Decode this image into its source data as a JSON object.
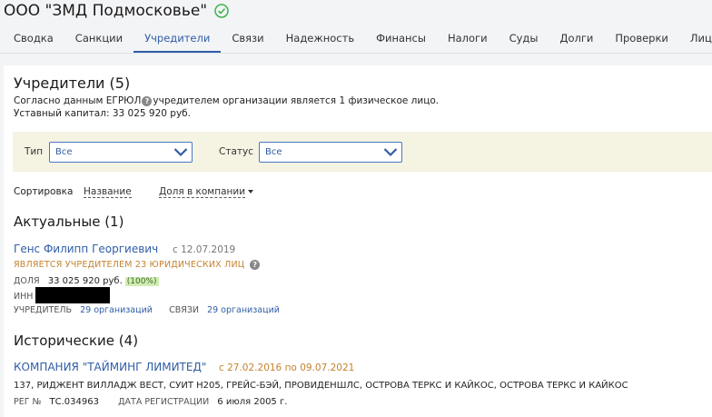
{
  "header": {
    "company": "ООО \"ЗМД Подмосковье\""
  },
  "tabs": [
    "Сводка",
    "Санкции",
    "Учредители",
    "Связи",
    "Надежность",
    "Финансы",
    "Налоги",
    "Суды",
    "Долги",
    "Проверки",
    "Лицен"
  ],
  "active_tab": "Учредители",
  "section": {
    "title": "Учредители (5)",
    "info_before": "Согласно данным ЕГРЮЛ",
    "info_after": "учредителем организации является 1 физическое лицо.",
    "capital": "Уставный капитал: 33 025 920 руб."
  },
  "filters": {
    "type_label": "Тип",
    "type_value": "Все",
    "status_label": "Статус",
    "status_value": "Все"
  },
  "sort": {
    "label": "Сортировка",
    "by_name": "Название",
    "by_share": "Доля в компании"
  },
  "actual": {
    "title": "Актуальные (1)",
    "person": "Генс Филипп Георгиевич",
    "since": "с 12.07.2019",
    "role": "ЯВЛЯЕТСЯ УЧРЕДИТЕЛЕМ 23 ЮРИДИЧЕСКИХ ЛИЦ",
    "share_label": "ДОЛЯ",
    "share_value": "33 025 920 руб.",
    "share_pct": "(100%)",
    "inn_label": "ИНН",
    "founder_label": "УЧРЕДИТЕЛЬ",
    "founder_link": "29 организаций",
    "links_label": "СВЯЗИ",
    "links_link": "29 организаций"
  },
  "historic": {
    "title": "Исторические (4)",
    "company": "КОМПАНИЯ \"ТАЙМИНГ ЛИМИТЕД\"",
    "dates": "с 27.02.2016 по 09.07.2021",
    "address": "137, РИДЖЕНТ ВИЛЛАДЖ ВЕСТ, СУИТ Н205, ГРЕЙС-БЭЙ, ПРОВИДЕНШЛС, ОСТРОВА ТЕРКС И КАЙКОС, ОСТРОВА ТЕРКС И КАЙКОС",
    "reg_label": "РЕГ №",
    "reg_value": "ТС.034963",
    "reg_date_label": "ДАТА РЕГИСТРАЦИИ",
    "reg_date_value": "6 июля 2005 г."
  },
  "colors": {
    "accent": "#2f5da6",
    "warning": "#c4832d",
    "badge_bg": "#d2ecb5",
    "filter_bg": "#f5f3e2",
    "check": "#3bb54a"
  },
  "icons": [
    "check-circle-icon",
    "help-icon",
    "chevron-down-icon",
    "caret-down-icon"
  ]
}
